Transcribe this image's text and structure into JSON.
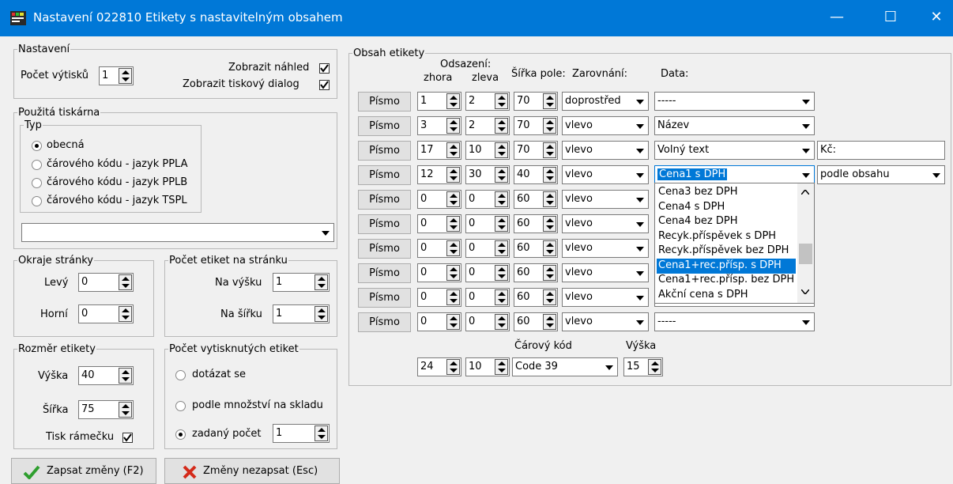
{
  "window": {
    "title": "Nastavení 022810 Etikety s nastavitelným obsahem",
    "icon": "app-icon",
    "minimize_icon": "—",
    "maximize_icon": "☐",
    "close_icon": "✕"
  },
  "nastaveni": {
    "legend": "Nastavení",
    "pocet_label": "Počet výtisků",
    "pocet_value": "1",
    "nahled_label": "Zobrazit náhled",
    "nahled_checked": true,
    "dialog_label": "Zobrazit tiskový dialog",
    "dialog_checked": true
  },
  "tiskarna": {
    "legend": "Použitá tiskárna",
    "typ_legend": "Typ",
    "options": [
      "obecná",
      "čárového kódu - jazyk PPLA",
      "čárového kódu - jazyk PPLB",
      "čárového kódu - jazyk TSPL"
    ],
    "selected": 0,
    "printer_value": ""
  },
  "okraje": {
    "legend": "Okraje stránky",
    "levy_label": "Levý",
    "levy_value": "0",
    "horni_label": "Horní",
    "horni_value": "0"
  },
  "pocet_etiket": {
    "legend": "Počet etiket na stránku",
    "vysku_label": "Na výšku",
    "vysku_value": "1",
    "sirku_label": "Na šířku",
    "sirku_value": "1"
  },
  "rozmer": {
    "legend": "Rozměr etikety",
    "vyska_label": "Výška",
    "vyska_value": "40",
    "sirka_label": "Šířka",
    "sirka_value": "75",
    "ramecek_label": "Tisk rámečku",
    "ramecek_checked": true
  },
  "vytisknutych": {
    "legend": "Počet vytisknutých etiket",
    "options": [
      "dotázat se",
      "podle množství na skladu",
      "zadaný počet"
    ],
    "selected": 2,
    "zadany_value": "1"
  },
  "buttons": {
    "save": "Zapsat změny (F2)",
    "cancel": "Změny nezapsat (Esc)"
  },
  "obsah": {
    "legend": "Obsah etikety",
    "headers": {
      "odsazeni": "Odsazení:",
      "zhora": "zhora",
      "zleva": "zleva",
      "sirka": "Šířka pole:",
      "zarovnani": "Zarovnání:",
      "data": "Data:"
    },
    "rows": [
      {
        "button": "Písmo",
        "zhora": "1",
        "zleva": "2",
        "sirka": "70",
        "zarovnani": "doprostřed",
        "data": "-----"
      },
      {
        "button": "Písmo",
        "zhora": "3",
        "zleva": "2",
        "sirka": "70",
        "zarovnani": "vlevo",
        "data": "Název"
      },
      {
        "button": "Písmo",
        "zhora": "17",
        "zleva": "10",
        "sirka": "70",
        "zarovnani": "vlevo",
        "data": "Volný text",
        "extra_text": "Kč:"
      },
      {
        "button": "Písmo",
        "zhora": "12",
        "zleva": "30",
        "sirka": "40",
        "zarovnani": "vlevo",
        "data": "Cena1 s DPH",
        "extra_combo": "podle obsahu"
      },
      {
        "button": "Písmo",
        "zhora": "0",
        "zleva": "0",
        "sirka": "60",
        "zarovnani": "vlevo",
        "data": ""
      },
      {
        "button": "Písmo",
        "zhora": "0",
        "zleva": "0",
        "sirka": "60",
        "zarovnani": "vlevo",
        "data": ""
      },
      {
        "button": "Písmo",
        "zhora": "0",
        "zleva": "0",
        "sirka": "60",
        "zarovnani": "vlevo",
        "data": ""
      },
      {
        "button": "Písmo",
        "zhora": "0",
        "zleva": "0",
        "sirka": "60",
        "zarovnani": "vlevo",
        "data": ""
      },
      {
        "button": "Písmo",
        "zhora": "0",
        "zleva": "0",
        "sirka": "60",
        "zarovnani": "vlevo",
        "data": ""
      },
      {
        "button": "Písmo",
        "zhora": "0",
        "zleva": "0",
        "sirka": "60",
        "zarovnani": "vlevo",
        "data": "-----"
      }
    ],
    "dropdown": {
      "options": [
        "Cena3 bez DPH",
        "Cena4 s DPH",
        "Cena4 bez DPH",
        "Recyk.příspěvek s DPH",
        "Recyk.příspěvek bez DPH",
        "Cena1+rec.přísp. s DPH",
        "Cena1+rec.přísp. bez DPH",
        "Akční cena s DPH"
      ],
      "highlighted": 5
    },
    "barcode": {
      "label": "Čárový kód",
      "vyska_label": "Výška",
      "zhora": "24",
      "zleva": "10",
      "type": "Code 39",
      "vyska": "15"
    }
  },
  "colors": {
    "accent": "#0078d7",
    "save_check": "#2e9e2e",
    "cancel_x": "#d42a1a"
  }
}
